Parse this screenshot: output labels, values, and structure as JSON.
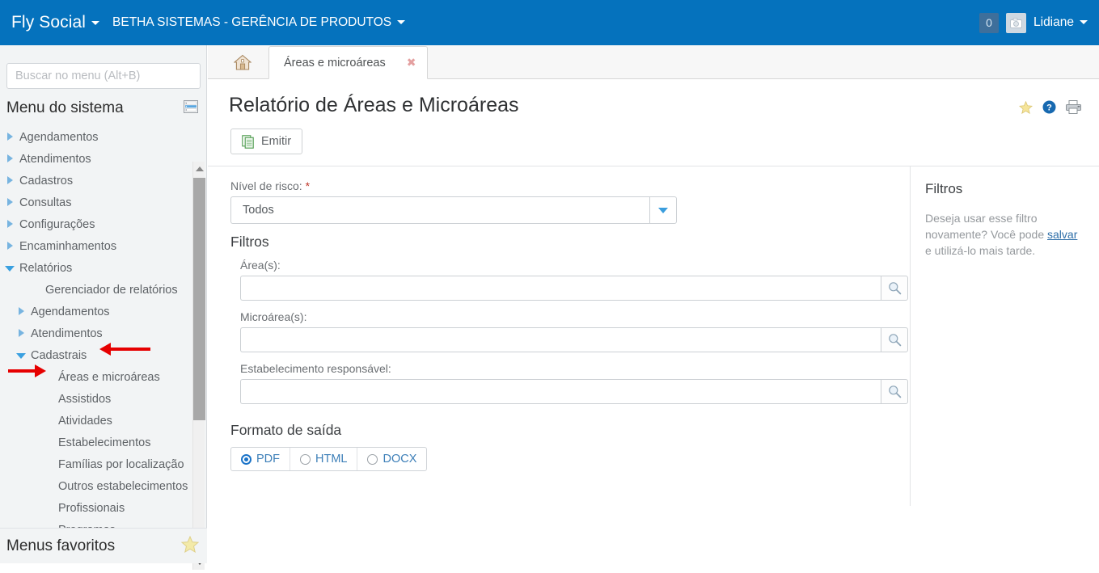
{
  "topbar": {
    "brand": "Fly Social",
    "org": "BETHA SISTEMAS - GERÊNCIA DE PRODUTOS",
    "badge_count": "0",
    "user_name": "Lidiane",
    "brand_caret_icon": "chevron-down-icon",
    "org_caret_icon": "chevron-down-icon",
    "avatar_icon": "camera-avatar-icon",
    "user_caret_icon": "chevron-down-icon",
    "background_color": "#0572bd"
  },
  "sidebar": {
    "search_placeholder": "Buscar no menu (Alt+B)",
    "search_value": "",
    "menu_title": "Menu do sistema",
    "menu_head_icon": "list-view-icon",
    "favorites_title": "Menus favoritos",
    "favorites_icon": "star-icon",
    "scroll_up_icon": "arrow-up-icon",
    "scroll_down_icon": "arrow-down-icon",
    "items": [
      {
        "label": "Agendamentos",
        "level": 1,
        "state": "collapsed"
      },
      {
        "label": "Atendimentos",
        "level": 1,
        "state": "collapsed"
      },
      {
        "label": "Cadastros",
        "level": 1,
        "state": "collapsed"
      },
      {
        "label": "Consultas",
        "level": 1,
        "state": "collapsed"
      },
      {
        "label": "Configurações",
        "level": 1,
        "state": "collapsed"
      },
      {
        "label": "Encaminhamentos",
        "level": 1,
        "state": "collapsed"
      },
      {
        "label": "Relatórios",
        "level": 1,
        "state": "expanded"
      },
      {
        "label": "Gerenciador de relatórios",
        "level": 2,
        "state": "leaf"
      },
      {
        "label": "Agendamentos",
        "level": 2,
        "state": "collapsed"
      },
      {
        "label": "Atendimentos",
        "level": 2,
        "state": "collapsed"
      },
      {
        "label": "Cadastrais",
        "level": 2,
        "state": "expanded"
      },
      {
        "label": "Áreas e microáreas",
        "level": 3,
        "state": "leaf"
      },
      {
        "label": "Assistidos",
        "level": 3,
        "state": "leaf"
      },
      {
        "label": "Atividades",
        "level": 3,
        "state": "leaf"
      },
      {
        "label": "Estabelecimentos",
        "level": 3,
        "state": "leaf"
      },
      {
        "label": "Famílias por localização",
        "level": 3,
        "state": "leaf"
      },
      {
        "label": "Outros estabelecimentos",
        "level": 3,
        "state": "leaf"
      },
      {
        "label": "Profissionais",
        "level": 3,
        "state": "leaf"
      },
      {
        "label": "Programas",
        "level": 3,
        "state": "leaf"
      }
    ]
  },
  "annotations": {
    "arrow_color": "#e60000",
    "arrow_1_target": "Cadastrais",
    "arrow_2_target": "Áreas e microáreas"
  },
  "tabs": {
    "home_icon": "home-icon",
    "items": [
      {
        "label": "Áreas e microáreas",
        "active": true,
        "close_icon": "close-icon"
      }
    ]
  },
  "page": {
    "title": "Relatório de Áreas e Microáreas",
    "actions": [
      {
        "icon": "star-icon",
        "name": "favorite-button"
      },
      {
        "icon": "help-icon",
        "name": "help-button"
      },
      {
        "icon": "printer-icon",
        "name": "print-button"
      }
    ],
    "emitir_label": "Emitir",
    "emitir_icon": "documents-icon"
  },
  "form": {
    "risk_label": "Nível de risco:",
    "risk_required": "*",
    "risk_value": "Todos",
    "filters_heading": "Filtros",
    "fields": [
      {
        "label": "Área(s):",
        "value": "",
        "placeholder": "",
        "search_icon": "magnifier-icon"
      },
      {
        "label": "Microárea(s):",
        "value": "",
        "placeholder": "",
        "search_icon": "magnifier-icon"
      },
      {
        "label": "Estabelecimento responsável:",
        "value": "",
        "placeholder": "",
        "search_icon": "magnifier-icon"
      }
    ],
    "output_heading": "Formato de saída",
    "output_options": [
      {
        "label": "PDF",
        "selected": true
      },
      {
        "label": "HTML",
        "selected": false
      },
      {
        "label": "DOCX",
        "selected": false
      }
    ]
  },
  "side_panel": {
    "heading": "Filtros",
    "text_before": "Deseja usar esse filtro novamente? Você pode ",
    "link": "salvar",
    "text_after": " e utilizá-lo mais tarde."
  }
}
